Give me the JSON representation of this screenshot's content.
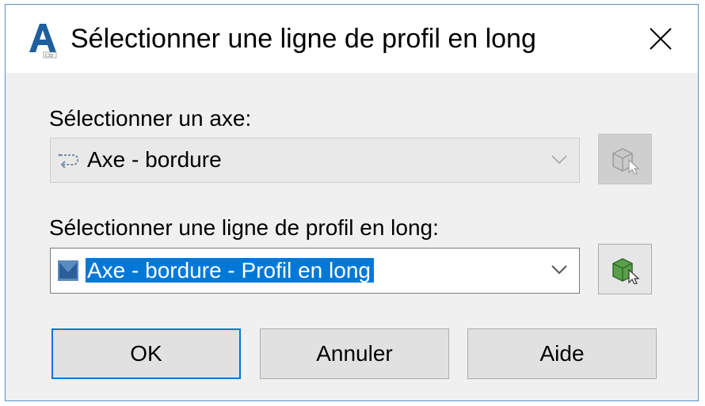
{
  "window": {
    "title": "Sélectionner une ligne de profil en long",
    "app_icon": "civil3d-app-icon",
    "close_icon": "close-icon"
  },
  "alignment": {
    "label": "Sélectionner un axe:",
    "value": "Axe - bordure",
    "icon": "alignment-icon",
    "enabled": false
  },
  "profile": {
    "label": "Sélectionner une ligne de profil en long:",
    "value": "Axe - bordure - Profil en long",
    "icon": "profile-icon",
    "enabled": true,
    "selected": true
  },
  "buttons": {
    "ok": "OK",
    "cancel": "Annuler",
    "help": "Aide"
  },
  "colors": {
    "accent": "#0078d7",
    "dialog_bg": "#f0f0f0"
  }
}
